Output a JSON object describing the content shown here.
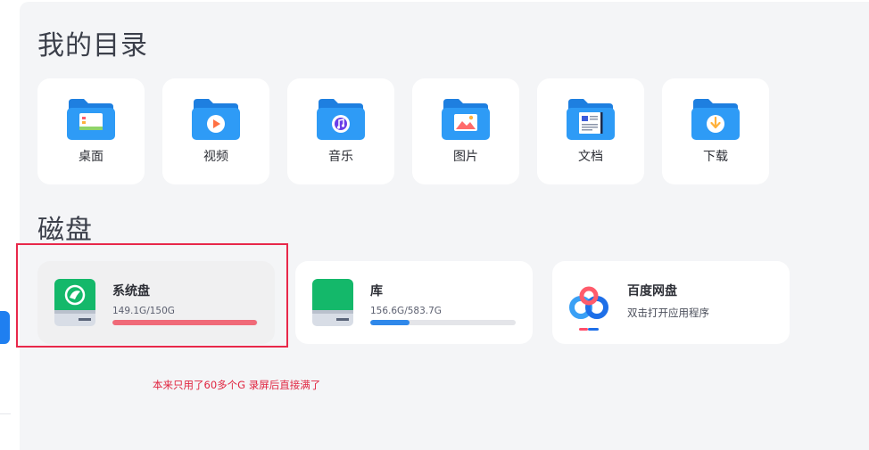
{
  "sections": {
    "dirs_title": "我的目录",
    "disks_title": "磁盘"
  },
  "directories": [
    {
      "label": "桌面",
      "icon": "desktop-folder-icon"
    },
    {
      "label": "视频",
      "icon": "video-folder-icon"
    },
    {
      "label": "音乐",
      "icon": "music-folder-icon"
    },
    {
      "label": "图片",
      "icon": "pictures-folder-icon"
    },
    {
      "label": "文档",
      "icon": "documents-folder-icon"
    },
    {
      "label": "下载",
      "icon": "downloads-folder-icon"
    }
  ],
  "disks": [
    {
      "name": "系统盘",
      "usage": "149.1G/150G",
      "used_fraction": 0.994,
      "bar_color": "#f06a78",
      "icon": "system-drive-icon"
    },
    {
      "name": "库",
      "usage": "156.6G/583.7G",
      "used_fraction": 0.268,
      "bar_color": "#2f88ea",
      "icon": "library-drive-icon"
    }
  ],
  "baidu": {
    "name": "百度网盘",
    "subtitle": "双击打开应用程序",
    "icon": "baidu-netdisk-icon"
  },
  "annotation": {
    "text": "本来只用了60多个G  录屏后直接满了",
    "color": "#e0243f"
  },
  "colors": {
    "folder_blue": "#2196f3",
    "accent_blue": "#1f7ff0",
    "drive_green": "#14b86a"
  }
}
